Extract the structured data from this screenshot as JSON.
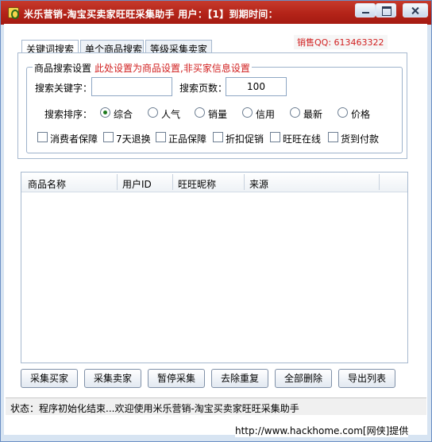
{
  "window": {
    "title": "米乐营销-淘宝买卖家旺旺采集助手  用户：【1】到期时间："
  },
  "tabs": [
    {
      "label": "关键词搜索",
      "active": true
    },
    {
      "label": "单个商品搜索",
      "active": false
    },
    {
      "label": "等级采集卖家",
      "active": false
    }
  ],
  "sales_qq": "销售QQ: 613463322",
  "search_group": {
    "label": "商品搜索设置",
    "note": "此处设置为商品设置,非买家信息设置",
    "keyword_label": "搜索关键字：",
    "keyword_value": "",
    "pages_label": "搜索页数：",
    "pages_value": "100",
    "sort_label": "搜索排序：",
    "sort_options": [
      {
        "label": "综合",
        "checked": true
      },
      {
        "label": "人气",
        "checked": false
      },
      {
        "label": "销量",
        "checked": false
      },
      {
        "label": "信用",
        "checked": false
      },
      {
        "label": "最新",
        "checked": false
      },
      {
        "label": "价格",
        "checked": false
      }
    ],
    "filters": [
      {
        "label": "消费者保障",
        "checked": false
      },
      {
        "label": "7天退换",
        "checked": false
      },
      {
        "label": "正品保障",
        "checked": false
      },
      {
        "label": "折扣促销",
        "checked": false
      },
      {
        "label": "旺旺在线",
        "checked": false
      },
      {
        "label": "货到付款",
        "checked": false
      }
    ]
  },
  "table": {
    "columns": [
      "商品名称",
      "用户ID",
      "旺旺昵称",
      "来源"
    ],
    "rows": []
  },
  "buttons": [
    "采集买家",
    "采集卖家",
    "暂停采集",
    "去除重复",
    "全部删除",
    "导出列表"
  ],
  "status": {
    "text": "状态：程序初始化结束...欢迎使用米乐营销-淘宝买卖家旺旺采集助手"
  },
  "watermark": "http://www.hackhome.com[网侠]提供",
  "colors": {
    "title_bar": "#b32318",
    "accent_red": "#d11f1f",
    "radio_dot": "#1e7a1e"
  }
}
